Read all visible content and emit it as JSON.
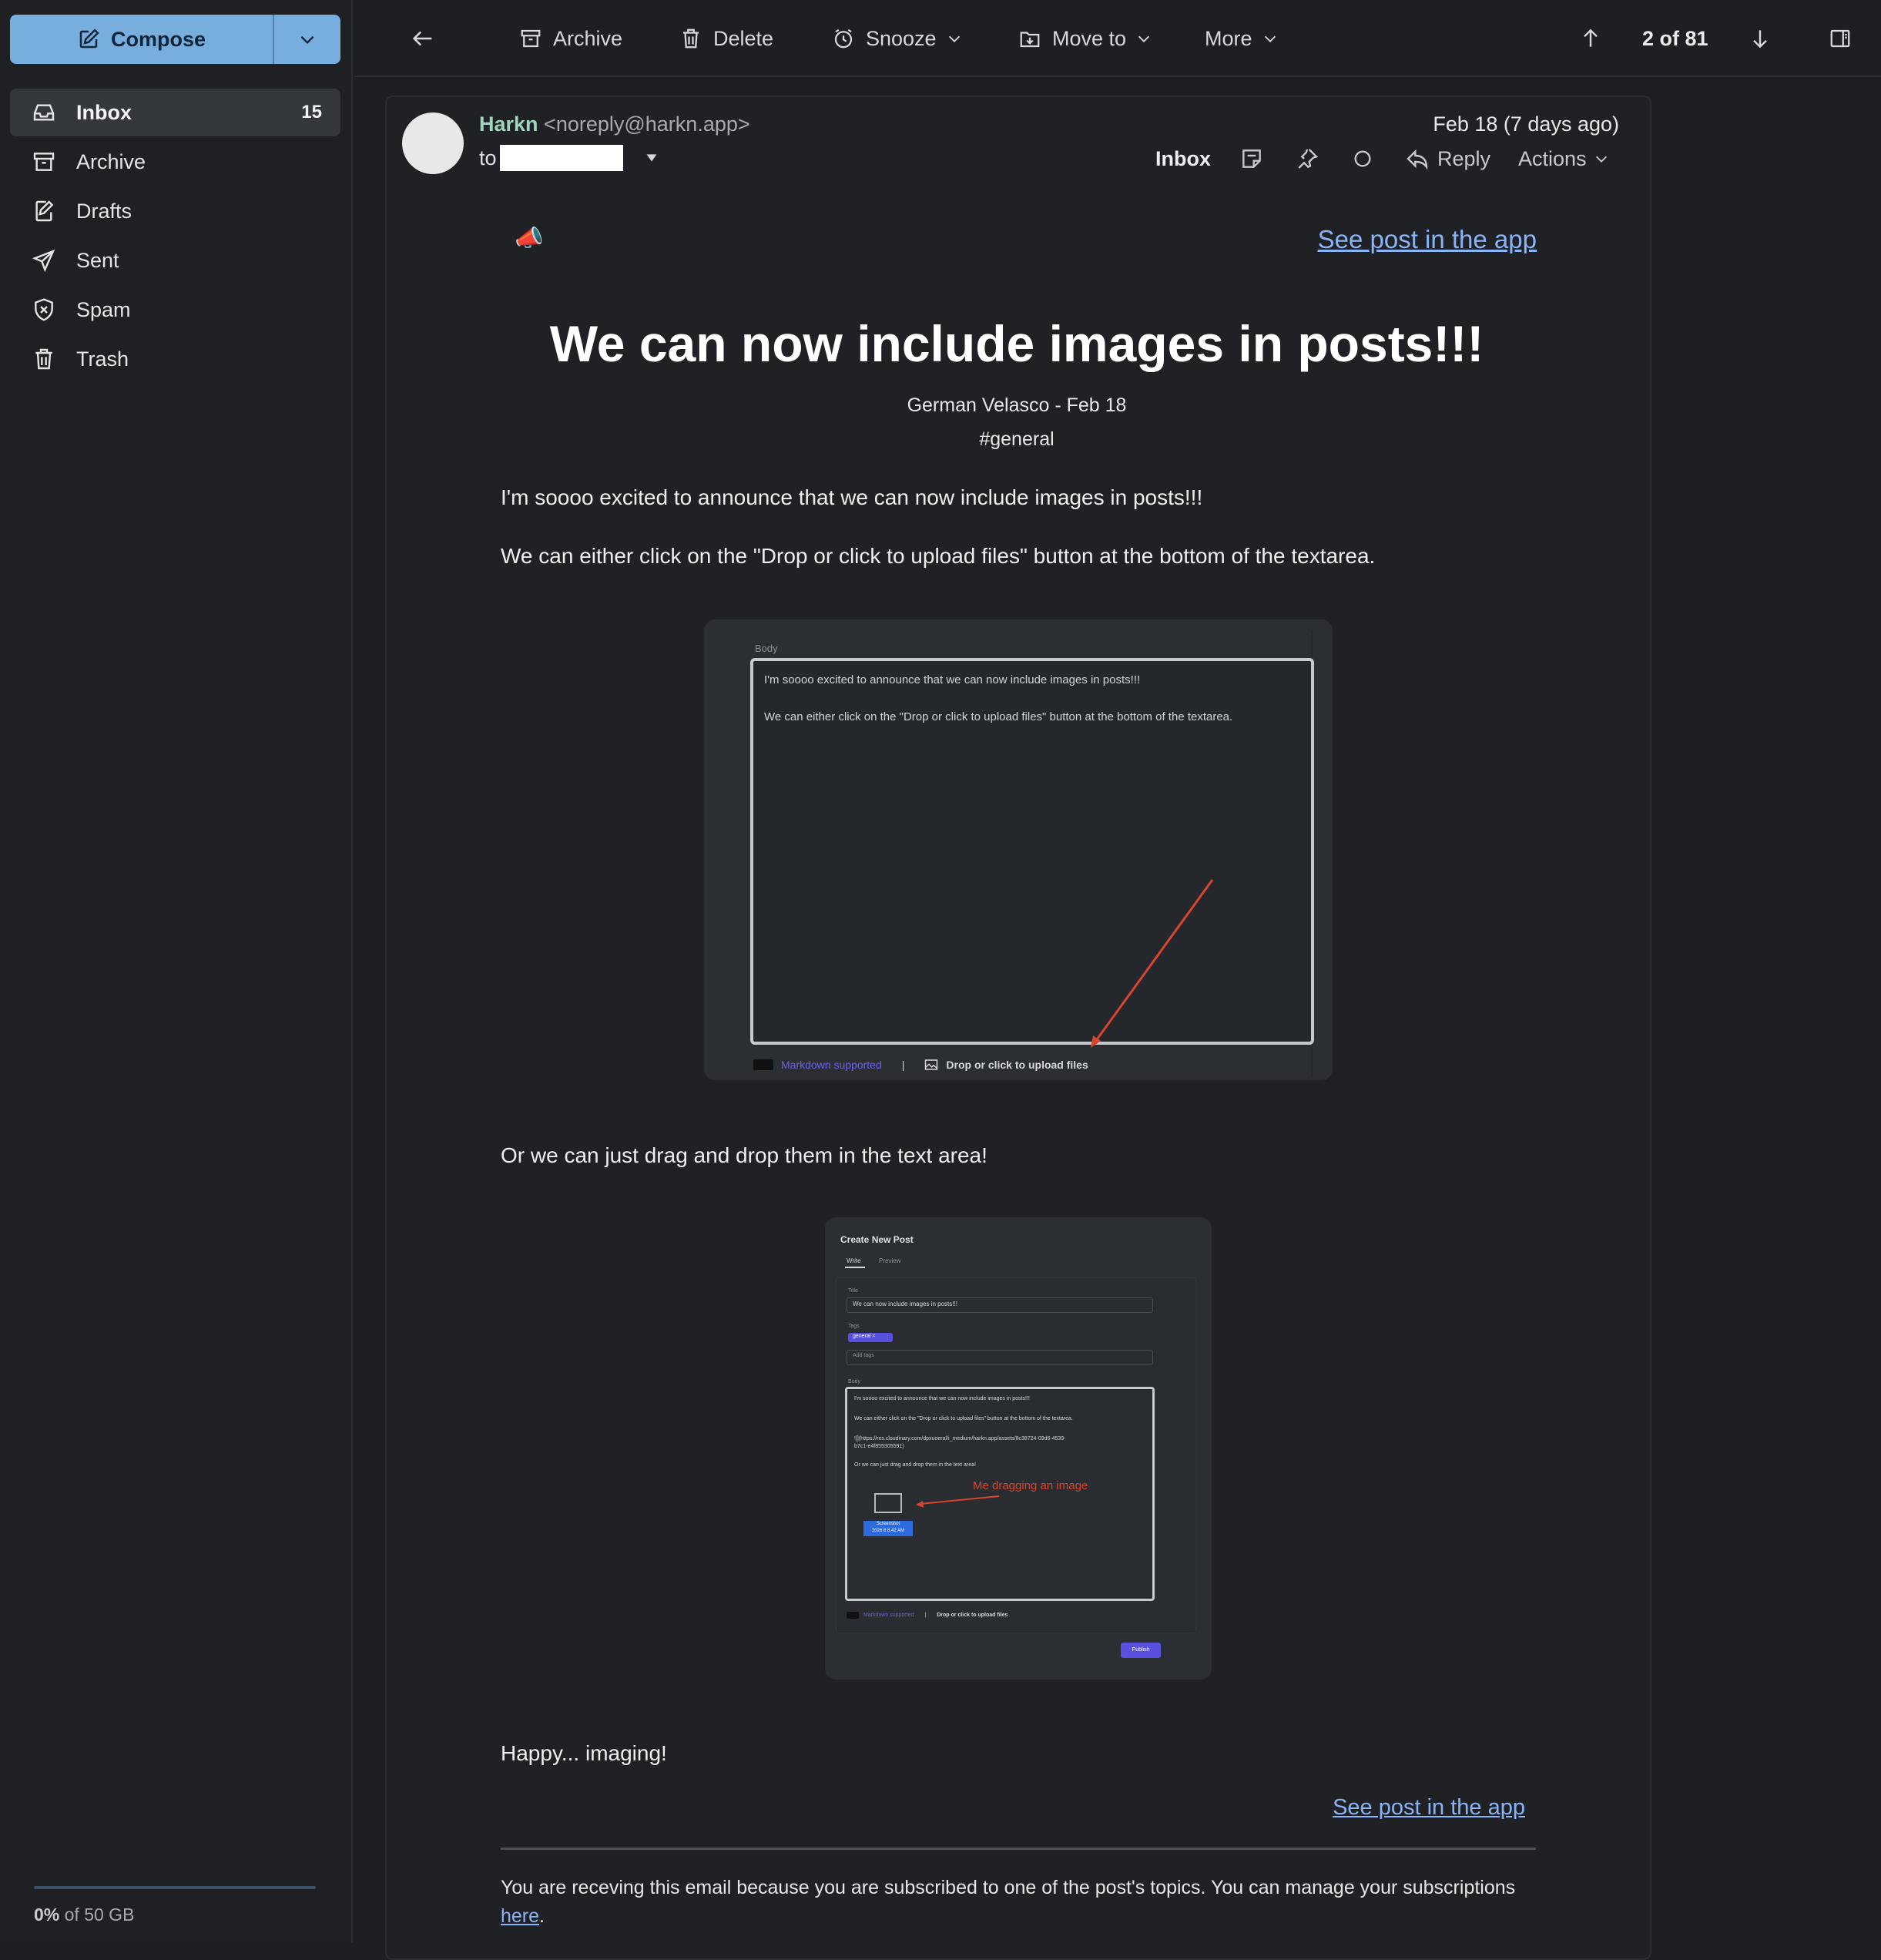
{
  "sidebar": {
    "compose_label": "Compose",
    "items": [
      {
        "label": "Inbox",
        "count": "15",
        "icon": "inbox-icon"
      },
      {
        "label": "Archive",
        "icon": "archive-icon"
      },
      {
        "label": "Drafts",
        "icon": "drafts-icon"
      },
      {
        "label": "Sent",
        "icon": "send-icon"
      },
      {
        "label": "Spam",
        "icon": "spam-icon"
      },
      {
        "label": "Trash",
        "icon": "trash-icon"
      }
    ],
    "storage": {
      "used": "0%",
      "rest": "of 50 GB"
    }
  },
  "toolbar": {
    "archive": "Archive",
    "delete": "Delete",
    "snooze": "Snooze",
    "move_to": "Move to",
    "more": "More",
    "pager": "2 of 81"
  },
  "message": {
    "sender_name": "Harkn",
    "sender_email": "<noreply@harkn.app>",
    "to_label": "to",
    "date": "Feb 18 (7 days ago)",
    "label": "Inbox",
    "reply": "Reply",
    "actions": "Actions"
  },
  "email": {
    "see_post": "See post in the app",
    "title": "We can now include images in posts!!!",
    "author_line": "German Velasco - Feb 18",
    "tag": "#general",
    "p1": "I'm soooo excited to announce that we can now include images in posts!!!",
    "p2": "We can either click on the \"Drop or click to upload files\" button at the bottom of the textarea.",
    "p3": "Or we can just drag and drop them in the text area!",
    "p4": "Happy... imaging!",
    "footer_text": "You are receving this email because you are subscribed to one of the post's topics. You can manage your subscriptions",
    "footer_link": "here",
    "footer_end": "."
  },
  "screenshot1": {
    "label": "Body",
    "line1": "I'm soooo excited to announce that we can now include images in posts!!!",
    "line2": "We can either click on the \"Drop or click to upload files\" button at the bottom of the textarea.",
    "markdown": "Markdown supported",
    "separator": "|",
    "upload": "Drop or click to upload files",
    "arrow_color": "#d7452f"
  },
  "screenshot2": {
    "heading": "Create New Post",
    "tab_write": "Write",
    "tab_preview": "Preview",
    "title_label": "Title",
    "title_value": "We can now include images in posts!!!",
    "tags_label": "Tags",
    "tag": "general ×",
    "add_tags": "Add tags",
    "body_label": "Body",
    "line1": "I'm soooo excited to announce that we can now include images in posts!!!",
    "line2": "We can either click on the \"Drop or click to upload files\" button at the bottom of the textarea.",
    "line3a": "![](https://res.cloudinary.com/dpxuoeral/i_medium/harkn.app/assets/8c38724-09d6-4539-",
    "line3b": "b7c1-e4f855305591)",
    "line4": "Or we can just drag and drop them in the text area!",
    "drag_note": "Me dragging an image",
    "file_name_1": "Screenshot",
    "file_name_2": "2026 8 8.42 AM",
    "markdown": "Markdown supported",
    "separator": "|",
    "upload": "Drop or click to upload files",
    "publish": "Publish"
  },
  "colors": {
    "compose": "#78aede",
    "sender": "#9fd4bd",
    "link": "#8ab4f8",
    "accent": "#5a50e0",
    "annotation": "#d7452f"
  }
}
